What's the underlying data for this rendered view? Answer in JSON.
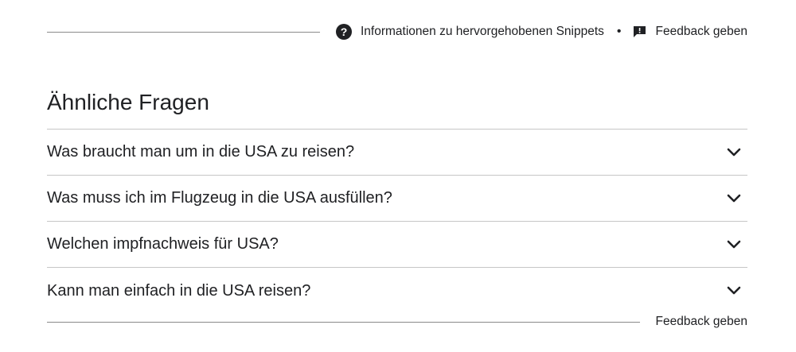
{
  "top_bar": {
    "info_label": "Informationen zu hervorgehobenen Snippets",
    "separator": "•",
    "feedback_label": "Feedback geben"
  },
  "section": {
    "title": "Ähnliche Fragen",
    "questions": [
      {
        "text": "Was braucht man um in die USA zu reisen?"
      },
      {
        "text": "Was muss ich im Flugzeug in die USA ausfüllen?"
      },
      {
        "text": "Welchen impfnachweis für USA?"
      },
      {
        "text": "Kann man einfach in die USA reisen?"
      }
    ]
  },
  "footer": {
    "feedback_label": "Feedback geben"
  },
  "icons": {
    "help": "help-circle-icon",
    "feedback": "feedback-flag-icon",
    "expand": "chevron-down-icon"
  }
}
